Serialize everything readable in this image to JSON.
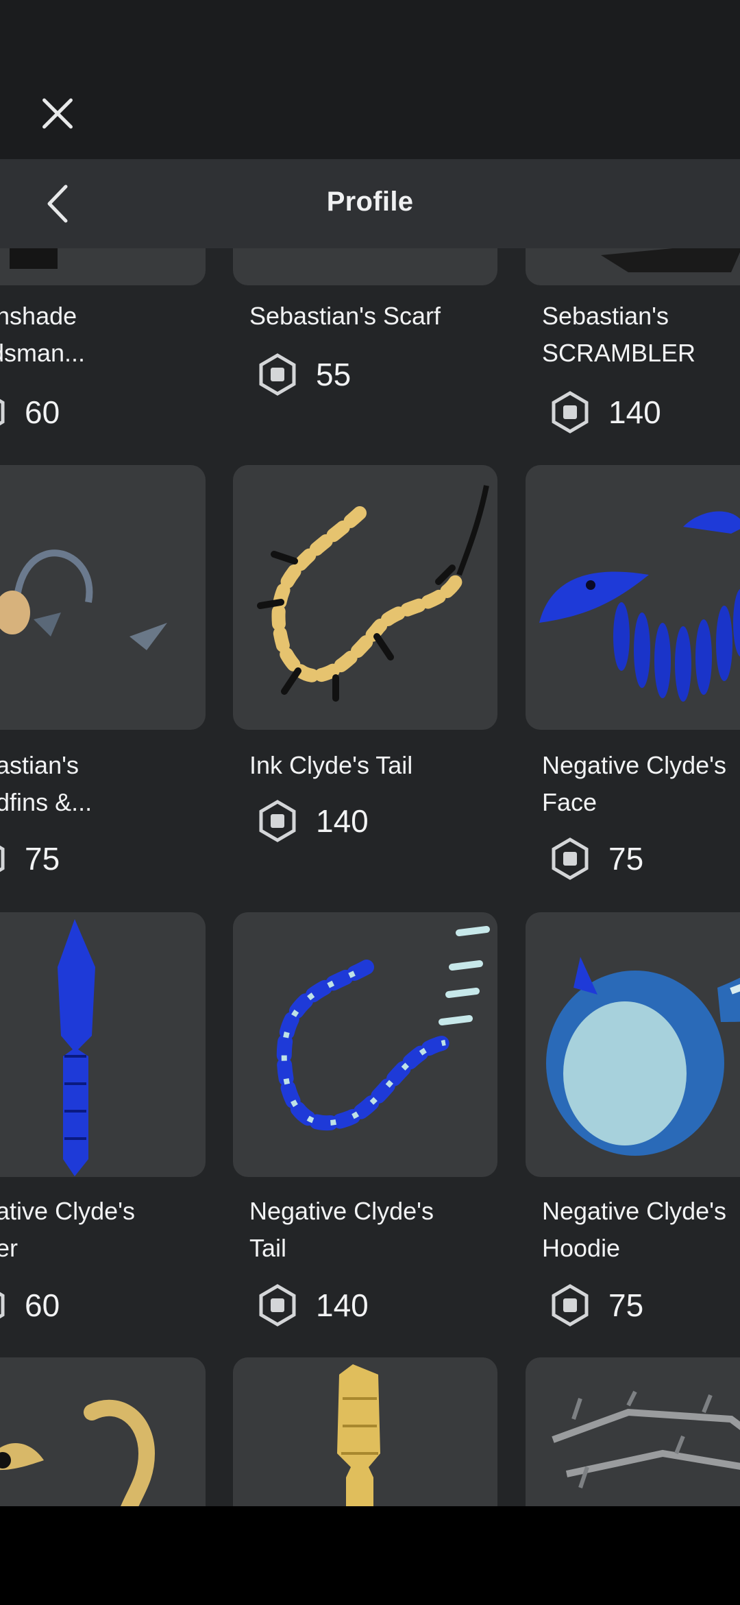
{
  "header": {
    "title": "Profile"
  },
  "items": [
    {
      "name_lines": [
        "Anglerfish Deepshade",
        "Guardsman..."
      ],
      "visible_name_lines": [
        "anshade",
        "rdsman..."
      ],
      "price": "60"
    },
    {
      "name_lines": [
        "Sebastian's Scarf"
      ],
      "price": "55"
    },
    {
      "name_lines": [
        "Sebastian's",
        "SCRAMBLER"
      ],
      "price": "140"
    },
    {
      "name_lines": [
        "Sebastian's",
        "Headfins &..."
      ],
      "visible_name_lines": [
        "bastian's",
        "adfins &..."
      ],
      "price": "75"
    },
    {
      "name_lines": [
        "Ink Clyde's Tail"
      ],
      "price": "140"
    },
    {
      "name_lines": [
        "Negative Clyde's",
        "Face"
      ],
      "price": "75"
    },
    {
      "name_lines": [
        "Negative Clyde's",
        "Ripper"
      ],
      "visible_name_lines": [
        "gative Clyde's",
        "per"
      ],
      "price": "60"
    },
    {
      "name_lines": [
        "Negative Clyde's",
        "Tail"
      ],
      "price": "140"
    },
    {
      "name_lines": [
        "Negative Clyde's",
        "Hoodie"
      ],
      "price": "75"
    }
  ],
  "icons": {
    "close": "close-icon",
    "back": "chevron-left-icon",
    "currency": "robux-icon"
  },
  "colors": {
    "background": "#232527",
    "header": "#2f3134",
    "card": "#393b3d",
    "blue_item": "#1e3ad8",
    "gold_item": "#d8b868"
  }
}
